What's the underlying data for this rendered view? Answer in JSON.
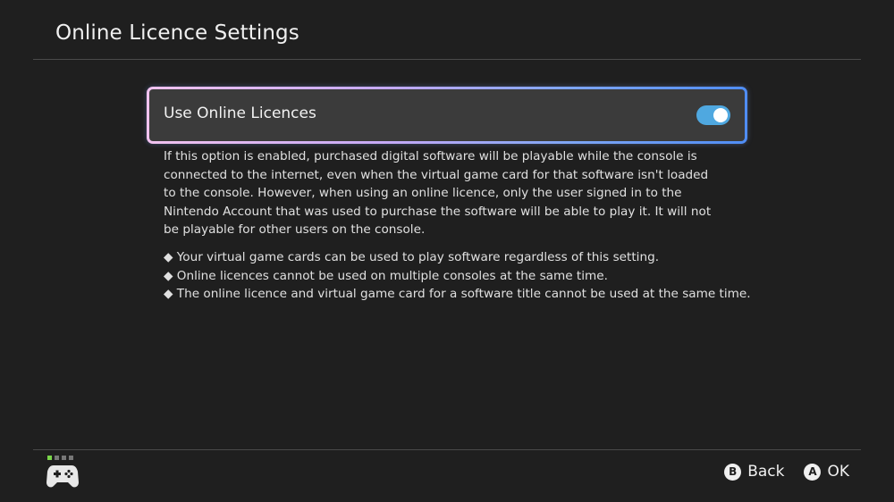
{
  "header": {
    "title": "Online Licence Settings"
  },
  "setting": {
    "label": "Use Online Licences",
    "enabled": true,
    "accent": "#4fa8e0"
  },
  "description": "If this option is enabled, purchased digital software will be playable while the console is connected to the internet, even when the virtual game card for that software isn't loaded to the console. However, when using an online licence, only the user signed in to the Nintendo Account that was used to purchase the software will be able to play it. It will not be playable for other users on the console.",
  "notes": [
    "◆ Your virtual game cards can be used to play software regardless of this setting.",
    "◆ Online licences cannot be used on multiple consoles at the same time.",
    "◆ The online licence and virtual game card for a software title cannot be used at the same time."
  ],
  "footer": {
    "controller_icon": "controller-icon",
    "player_indicator": {
      "active": 1,
      "total": 4
    },
    "back": {
      "key": "B",
      "label": "Back"
    },
    "ok": {
      "key": "A",
      "label": "OK"
    }
  }
}
